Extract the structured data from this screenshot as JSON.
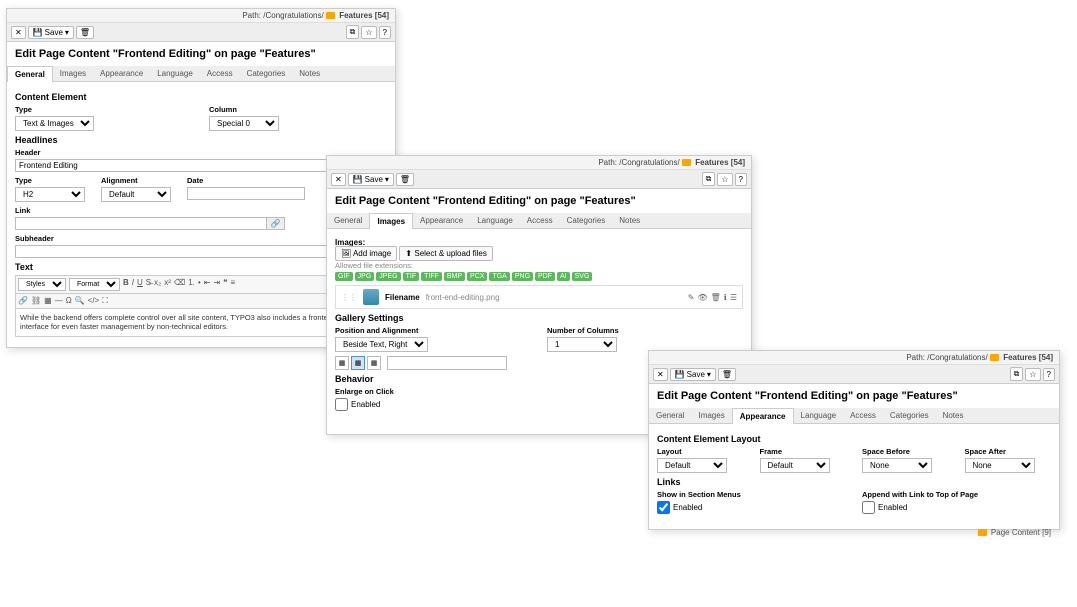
{
  "path_prefix": "Path:",
  "path_value": "/Congratulations/",
  "path_feat": "Features [54]",
  "page_title": "Edit Page Content \"Frontend Editing\" on page \"Features\"",
  "tabs": {
    "general": "General",
    "images": "Images",
    "appearance": "Appearance",
    "language": "Language",
    "access": "Access",
    "categories": "Categories",
    "notes": "Notes"
  },
  "toolbar": {
    "save": "Save"
  },
  "panel1": {
    "content_element": "Content Element",
    "type": "Type",
    "type_value": "Text & Images",
    "column": "Column",
    "column_value": "Special 0",
    "headlines": "Headlines",
    "header": "Header",
    "header_value": "Frontend Editing",
    "type2": "Type",
    "type2_value": "H2",
    "alignment": "Alignment",
    "alignment_value": "Default",
    "date": "Date",
    "date_value": "",
    "link": "Link",
    "link_value": "",
    "subheader": "Subheader",
    "subheader_value": "",
    "text": "Text",
    "rte_style": "Styles",
    "rte_format": "Format",
    "rte_content": "While the backend offers complete control over all site content, TYPO3 also includes a frontend editing interface for even faster management by non-technical editors."
  },
  "panel2": {
    "images": "Images:",
    "add_image": "Add image",
    "select_upload": "Select & upload files",
    "allowed_ext": "Allowed file extensions:",
    "exts": [
      "GIF",
      "JPG",
      "JPEG",
      "TIF",
      "TIFF",
      "BMP",
      "PCX",
      "TGA",
      "PNG",
      "PDF",
      "AI",
      "SVG"
    ],
    "filename": "Filename",
    "file_value": "front-end-editing.png",
    "gallery": "Gallery Settings",
    "pos_align": "Position and Alignment",
    "pos_value": "Beside Text, Right",
    "num_cols": "Number of Columns",
    "num_cols_value": "1",
    "behavior": "Behavior",
    "enlarge": "Enlarge on Click",
    "enabled": "Enabled"
  },
  "panel3": {
    "layout_head": "Content Element Layout",
    "layout": "Layout",
    "layout_value": "Default",
    "frame": "Frame",
    "frame_value": "Default",
    "space_before": "Space Before",
    "space_before_value": "None",
    "space_after": "Space After",
    "space_after_value": "None",
    "links": "Links",
    "show_menus": "Show in Section Menus",
    "append_top": "Append with Link to Top of Page",
    "enabled": "Enabled",
    "page_content": "Page Content",
    "page_content_count": "[9]"
  }
}
